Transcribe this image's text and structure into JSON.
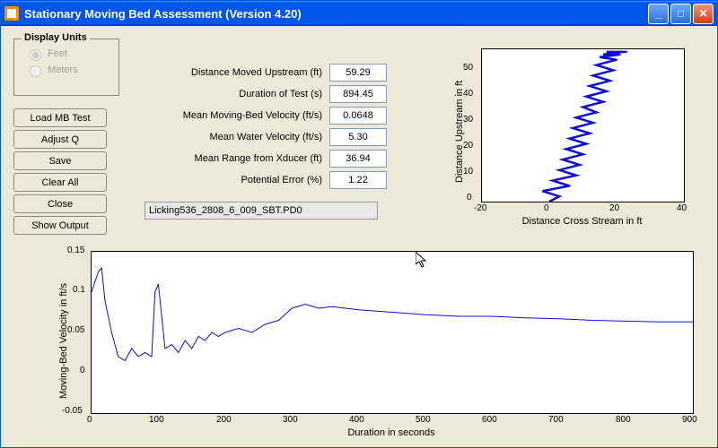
{
  "window": {
    "title": "Stationary Moving Bed Assessment  (Version 4.20)"
  },
  "display_units": {
    "legend": "Display Units",
    "feet": "Feet",
    "meters": "Meters"
  },
  "buttons": {
    "load": "Load MB Test",
    "adjustq": "Adjust Q",
    "save": "Save",
    "clear": "Clear All",
    "close": "Close",
    "show": "Show Output"
  },
  "fields": {
    "dist_up": {
      "label": "Distance Moved Upstream (ft)",
      "value": "59.29"
    },
    "duration": {
      "label": "Duration of Test (s)",
      "value": "894.45"
    },
    "mbvel": {
      "label": "Mean Moving-Bed Velocity (ft/s)",
      "value": "0.0648"
    },
    "wvel": {
      "label": "Mean Water Velocity (ft/s)",
      "value": "5.30"
    },
    "range": {
      "label": "Mean Range from Xducer (ft)",
      "value": "36.94"
    },
    "perr": {
      "label": "Potential Error (%)",
      "value": "1.22"
    }
  },
  "filename": "Licking536_2808_6_009_SBT.PD0",
  "track_chart": {
    "xlabel": "Distance Cross Stream in ft",
    "ylabel": "Distance Upstream in ft",
    "xticks": [
      "-20",
      "0",
      "20",
      "40"
    ],
    "yticks": [
      "0",
      "10",
      "20",
      "30",
      "40",
      "50"
    ]
  },
  "vel_chart": {
    "xlabel": "Duration in seconds",
    "ylabel": "Moving-Bed Velocity in ft/s",
    "xticks": [
      "0",
      "100",
      "200",
      "300",
      "400",
      "500",
      "600",
      "700",
      "800",
      "900"
    ],
    "yticks": [
      "-0.05",
      "0",
      "0.05",
      "0.1",
      "0.15"
    ]
  },
  "chart_data": [
    {
      "type": "line",
      "title": "",
      "xlabel": "Distance Cross Stream in ft",
      "ylabel": "Distance Upstream in ft",
      "xlim": [
        -20,
        40
      ],
      "ylim": [
        0,
        58
      ],
      "series": [
        {
          "name": "track",
          "x": [
            0,
            3,
            -2,
            6,
            1,
            8,
            3,
            9,
            4,
            10,
            5,
            11,
            6,
            12,
            7,
            13,
            8,
            14,
            10,
            16,
            11,
            17,
            12,
            18,
            13,
            19,
            14,
            20,
            15,
            21,
            16,
            22,
            17,
            23
          ],
          "y": [
            0,
            2,
            4,
            6,
            8,
            10,
            12,
            14,
            16,
            18,
            20,
            22,
            24,
            26,
            28,
            30,
            32,
            34,
            36,
            38,
            40,
            42,
            44,
            46,
            48,
            50,
            52,
            54,
            55,
            56,
            56,
            57,
            57,
            57
          ]
        }
      ]
    },
    {
      "type": "line",
      "title": "",
      "xlabel": "Duration in seconds",
      "ylabel": "Moving-Bed Velocity in ft/s",
      "xlim": [
        0,
        900
      ],
      "ylim": [
        -0.05,
        0.15
      ],
      "series": [
        {
          "name": "mb-velocity",
          "x": [
            0,
            10,
            15,
            20,
            30,
            40,
            50,
            60,
            70,
            80,
            90,
            95,
            100,
            110,
            120,
            130,
            140,
            150,
            160,
            170,
            180,
            190,
            200,
            220,
            240,
            260,
            280,
            300,
            320,
            340,
            360,
            380,
            400,
            450,
            500,
            550,
            600,
            650,
            700,
            750,
            800,
            850,
            900
          ],
          "y": [
            0.1,
            0.125,
            0.13,
            0.09,
            0.05,
            0.02,
            0.015,
            0.03,
            0.02,
            0.025,
            0.02,
            0.1,
            0.11,
            0.03,
            0.035,
            0.025,
            0.04,
            0.03,
            0.045,
            0.04,
            0.05,
            0.045,
            0.05,
            0.055,
            0.05,
            0.06,
            0.065,
            0.08,
            0.085,
            0.08,
            0.082,
            0.08,
            0.078,
            0.075,
            0.072,
            0.07,
            0.07,
            0.068,
            0.067,
            0.065,
            0.064,
            0.063,
            0.063
          ]
        }
      ]
    }
  ]
}
